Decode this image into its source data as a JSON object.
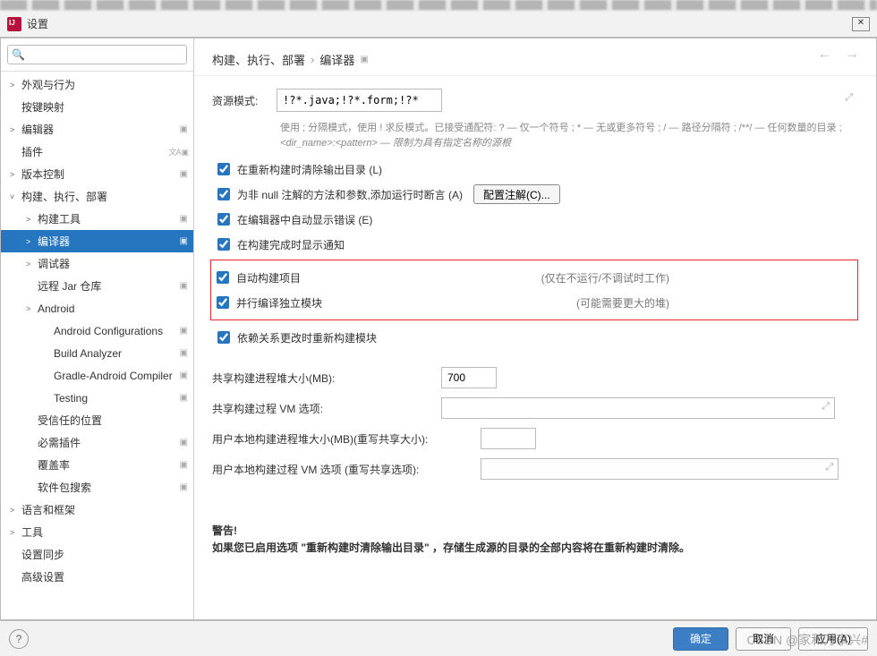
{
  "window": {
    "title": "设置"
  },
  "search": {
    "placeholder": ""
  },
  "sidebar": {
    "items": [
      {
        "label": "外观与行为",
        "arrow": ">",
        "depth": 0
      },
      {
        "label": "按键映射",
        "arrow": "",
        "depth": 0
      },
      {
        "label": "编辑器",
        "arrow": ">",
        "depth": 0,
        "tag": "▣"
      },
      {
        "label": "插件",
        "arrow": "",
        "depth": 0,
        "lang": "文A ▣"
      },
      {
        "label": "版本控制",
        "arrow": ">",
        "depth": 0,
        "tag": "▣"
      },
      {
        "label": "构建、执行、部署",
        "arrow": "˅",
        "depth": 0
      },
      {
        "label": "构建工具",
        "arrow": ">",
        "depth": 1,
        "tag": "▣"
      },
      {
        "label": "编译器",
        "arrow": ">",
        "depth": 1,
        "tag": "▣",
        "selected": true
      },
      {
        "label": "调试器",
        "arrow": ">",
        "depth": 1
      },
      {
        "label": "远程 Jar 仓库",
        "arrow": "",
        "depth": 1,
        "tag": "▣"
      },
      {
        "label": "Android",
        "arrow": ">",
        "depth": 1
      },
      {
        "label": "Android Configurations",
        "arrow": "",
        "depth": 2,
        "tag": "▣"
      },
      {
        "label": "Build Analyzer",
        "arrow": "",
        "depth": 2,
        "tag": "▣"
      },
      {
        "label": "Gradle-Android Compiler",
        "arrow": "",
        "depth": 2,
        "tag": "▣"
      },
      {
        "label": "Testing",
        "arrow": "",
        "depth": 2,
        "tag": "▣"
      },
      {
        "label": "受信任的位置",
        "arrow": "",
        "depth": 1
      },
      {
        "label": "必需插件",
        "arrow": "",
        "depth": 1,
        "tag": "▣"
      },
      {
        "label": "覆盖率",
        "arrow": "",
        "depth": 1,
        "tag": "▣"
      },
      {
        "label": "软件包搜索",
        "arrow": "",
        "depth": 1,
        "tag": "▣"
      },
      {
        "label": "语言和框架",
        "arrow": ">",
        "depth": 0
      },
      {
        "label": "工具",
        "arrow": ">",
        "depth": 0
      },
      {
        "label": "设置同步",
        "arrow": "",
        "depth": 0
      },
      {
        "label": "高级设置",
        "arrow": "",
        "depth": 0
      }
    ]
  },
  "breadcrumb": {
    "parent": "构建、执行、部署",
    "current": "编译器",
    "tag": "▣"
  },
  "form": {
    "patternLabel": "资源模式:",
    "patternValue": "!?*.java;!?*.form;!?*.class;!?*.groovy;!?*.scala;!?*.flex;!?*.kt;!?*.clj;!?*.aj",
    "hint1": "使用 ; 分隔模式，使用 ! 求反模式。已接受通配符: ? — 仅一个符号 ; * — 无或更多符号 ; / — 路径分隔符 ; /**/ — 任何数量的目录 ;",
    "hint2": "<dir_name>:<pattern> — 限制为具有指定名称的源根",
    "cb1": "在重新构建时清除输出目录 (L)",
    "cb2": "为非 null 注解的方法和参数,添加运行时断言 (A)",
    "cb2btn": "配置注解(C)...",
    "cb3": "在编辑器中自动显示错误 (E)",
    "cb4": "在构建完成时显示通知",
    "cb5": "自动构建项目",
    "cb5note": "(仅在不运行/不调试时工作)",
    "cb6": "并行编译独立模块",
    "cb6note": "(可能需要更大的堆)",
    "cb7": "依赖关系更改时重新构建模块",
    "heapLabel": "共享构建进程堆大小(MB):",
    "heapValue": "700",
    "vmLabel": "共享构建过程 VM 选项:",
    "userHeapLabel": "用户本地构建进程堆大小(MB)(重写共享大小):",
    "userVmLabel": "用户本地构建过程 VM 选项 (重写共享选项):",
    "warnTitle": "警告!",
    "warnBody": "如果您已启用选项 \"重新构建时清除输出目录\" ，存储生成源的目录的全部内容将在重新构建时清除。"
  },
  "footer": {
    "ok": "确定",
    "cancel": "取消",
    "apply": "应用(A)"
  },
  "watermark": "CSDN @家和万事兴#"
}
